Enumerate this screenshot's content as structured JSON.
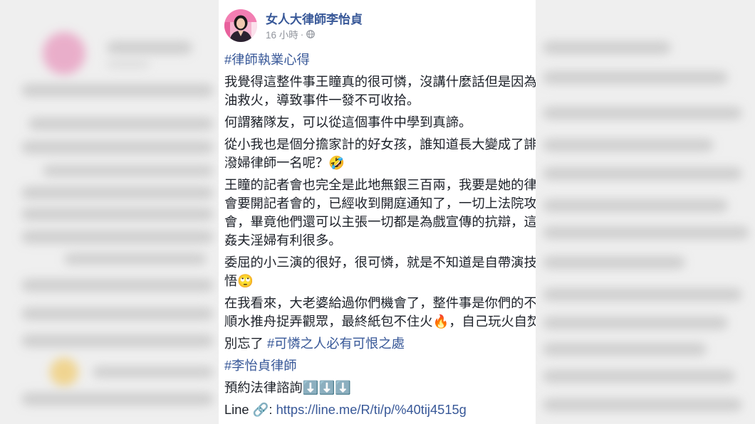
{
  "post": {
    "author": "女人大律師李怡貞",
    "time": "16 小時",
    "separator": "·",
    "privacy_icon": "globe-icon",
    "avatar_icon": "profile-photo",
    "tags_top": "#律師執業心得",
    "paragraphs": [
      [
        "我覺得這整件事王瞳真的很可憐，沒講什麼話但是因為",
        "油救火，導致事件一發不可收拾。"
      ],
      [
        "何謂豬隊友，可以從這個事件中學到真諦。"
      ],
      [
        "從小我也是個分擔家計的好女孩，誰知道長大變成了誹",
        "潑婦律師一名呢？🤣"
      ],
      [
        "王瞳的記者會也完全是此地無銀三百兩，我要是她的律",
        "會要開記者會的，已經收到開庭通知了，一切上法院攻",
        "會，畢竟他們還可以主張一切都是為戲宣傳的抗辯，這",
        "姦夫淫婦有利很多。"
      ],
      [
        "委屈的小三演的很好，很可憐，就是不知道是自帶演技",
        "悟🙄"
      ],
      [
        "在我看來，大老婆給過你們機會了，整件事是你們的不",
        "順水推舟捉弄觀眾，最終紙包不住火🔥，自己玩火自焚"
      ]
    ],
    "closing": {
      "prefix": "別忘了 ",
      "hashtag": "#可憐之人必有可恨之處"
    },
    "tags_bottom": "#李怡貞律師",
    "booking": "預約法律諮詢⬇️⬇️⬇️",
    "contact": {
      "prefix": "Line 🔗: ",
      "url": "https://line.me/R/ti/p/%40tij4515g"
    }
  },
  "colors": {
    "link": "#385898",
    "text": "#1d2129",
    "meta": "#90949c",
    "card_background": "#ffffff",
    "blurred_background": "#efefef"
  }
}
